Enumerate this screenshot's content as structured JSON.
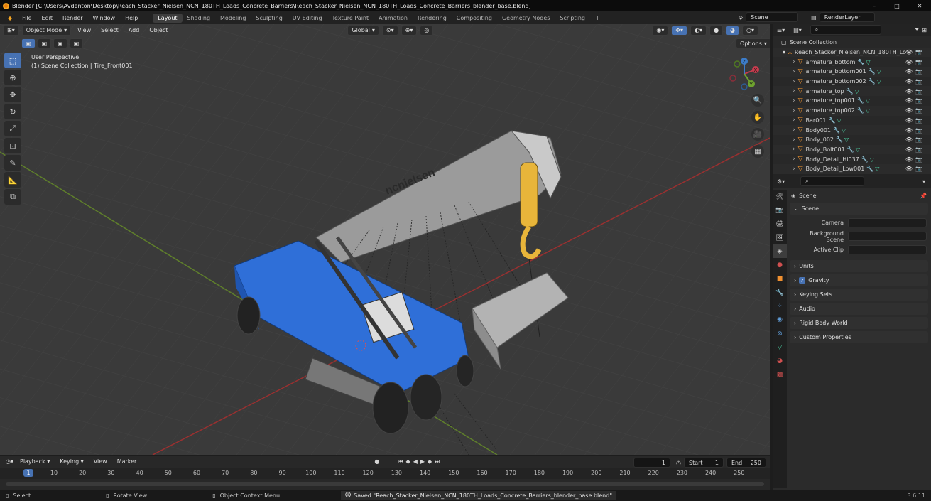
{
  "titlebar": {
    "title": "Blender [C:\\Users\\Avdenton\\Desktop\\Reach_Stacker_Nielsen_NCN_180TH_Loads_Concrete_Barriers\\Reach_Stacker_Nielsen_NCN_180TH_Loads_Concrete_Barriers_blender_base.blend]",
    "minimize": "–",
    "maximize": "□",
    "close": "✕"
  },
  "menus": [
    "File",
    "Edit",
    "Render",
    "Window",
    "Help"
  ],
  "workspaces": [
    "Layout",
    "Shading",
    "Modeling",
    "Sculpting",
    "UV Editing",
    "Texture Paint",
    "Animation",
    "Rendering",
    "Compositing",
    "Geometry Nodes",
    "Scripting"
  ],
  "workspace_add": "+",
  "scene_name": "Scene",
  "view_layer": "RenderLayer",
  "viewport": {
    "mode": "Object Mode",
    "menus": [
      "View",
      "Select",
      "Add",
      "Object"
    ],
    "orientation": "Global",
    "options": "Options",
    "info_line1": "User Perspective",
    "info_line2": "(1) Scene Collection | Tire_Front001",
    "logo_text": "ncnielsen",
    "gizmo": {
      "x": "X",
      "y": "Y",
      "z": "Z"
    }
  },
  "outliner": {
    "root": "Scene Collection",
    "collection": "Reach_Stacker_Nielsen_NCN_180TH_Lo",
    "items": [
      "armature_bottom",
      "armature_bottom001",
      "armature_bottom002",
      "armature_top",
      "armature_top001",
      "armature_top002",
      "Bar001",
      "Body001",
      "Body_002",
      "Body_Bolt001",
      "Body_Detail_Hi037",
      "Body_Detail_Low001"
    ]
  },
  "properties": {
    "header": "Scene",
    "section": "Scene",
    "fields": [
      "Camera",
      "Background Scene",
      "Active Clip"
    ],
    "panels": [
      "Units",
      "Gravity",
      "Keying Sets",
      "Audio",
      "Rigid Body World",
      "Custom Properties"
    ],
    "gravity_checked": true
  },
  "timeline": {
    "menus": [
      "Playback",
      "Keying",
      "View",
      "Marker"
    ],
    "current_frame": "1",
    "start_label": "Start",
    "start": "1",
    "end_label": "End",
    "end": "250",
    "ticks": [
      "10",
      "20",
      "30",
      "40",
      "50",
      "60",
      "70",
      "80",
      "90",
      "100",
      "110",
      "120",
      "130",
      "140",
      "150",
      "160",
      "170",
      "180",
      "190",
      "200",
      "210",
      "220",
      "230",
      "240",
      "250"
    ],
    "playhead": "1"
  },
  "status": {
    "select": "Select",
    "rotate": "Rotate View",
    "context": "Object Context Menu",
    "saved": "Saved \"Reach_Stacker_Nielsen_NCN_180TH_Loads_Concrete_Barriers_blender_base.blend\"",
    "version": "3.6.11"
  },
  "colors": {
    "accent": "#4772b3",
    "machine_blue": "#2f6fd8",
    "hook_yellow": "#e8b53a",
    "grid_red": "#9a3030",
    "grid_green": "#5f7f2b"
  }
}
